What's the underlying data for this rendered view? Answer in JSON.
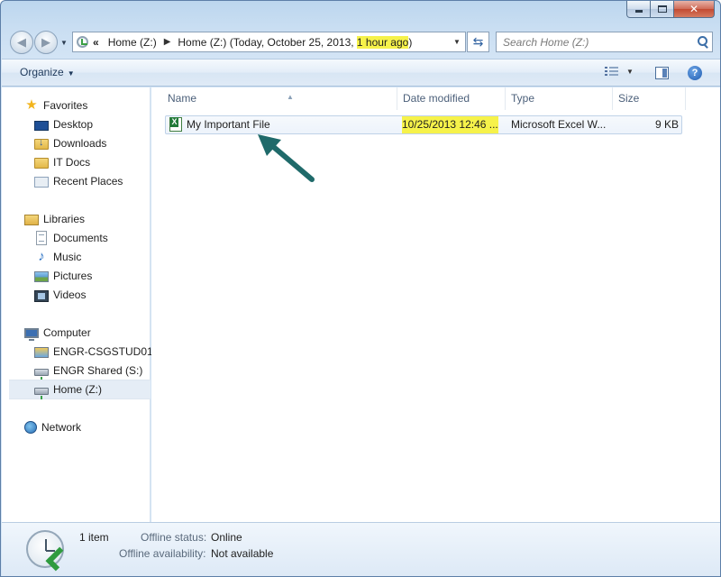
{
  "window": {
    "buttons": {
      "minimize": "minimize-icon",
      "maximize": "maximize-icon",
      "close": "close-icon"
    }
  },
  "address_bar": {
    "overflow_glyph": "«",
    "crumbs": [
      "Home (Z:)"
    ],
    "current_prefix": "Home (Z:) (Today, October 25, 2013, ",
    "current_highlight": "1 hour ago",
    "current_suffix": ")",
    "highlight_color": "#f6f24a"
  },
  "search": {
    "placeholder": "Search Home (Z:)"
  },
  "toolbar": {
    "organize_label": "Organize"
  },
  "nav_pane": {
    "favorites": {
      "label": "Favorites",
      "items": [
        "Desktop",
        "Downloads",
        "IT Docs",
        "Recent Places"
      ]
    },
    "libraries": {
      "label": "Libraries",
      "items": [
        "Documents",
        "Music",
        "Pictures",
        "Videos"
      ]
    },
    "computer": {
      "label": "Computer",
      "items": [
        "ENGR-CSGSTUD01 (",
        "ENGR Shared (S:)",
        "Home (Z:)"
      ],
      "selected": "Home (Z:)"
    },
    "network": {
      "label": "Network"
    }
  },
  "file_list": {
    "columns": [
      "Name",
      "Date modified",
      "Type",
      "Size"
    ],
    "rows": [
      {
        "name": "My Important File",
        "date_modified": "10/25/2013 12:46 ...",
        "type": "Microsoft Excel W...",
        "size": "9 KB",
        "icon": "excel-file-icon"
      }
    ]
  },
  "annotation": {
    "arrow_color": "#1f6a6a"
  },
  "details": {
    "count": "1 item",
    "offline_status_label": "Offline status:",
    "offline_status_value": "Online",
    "offline_availability_label": "Offline availability:",
    "offline_availability_value": "Not available"
  }
}
